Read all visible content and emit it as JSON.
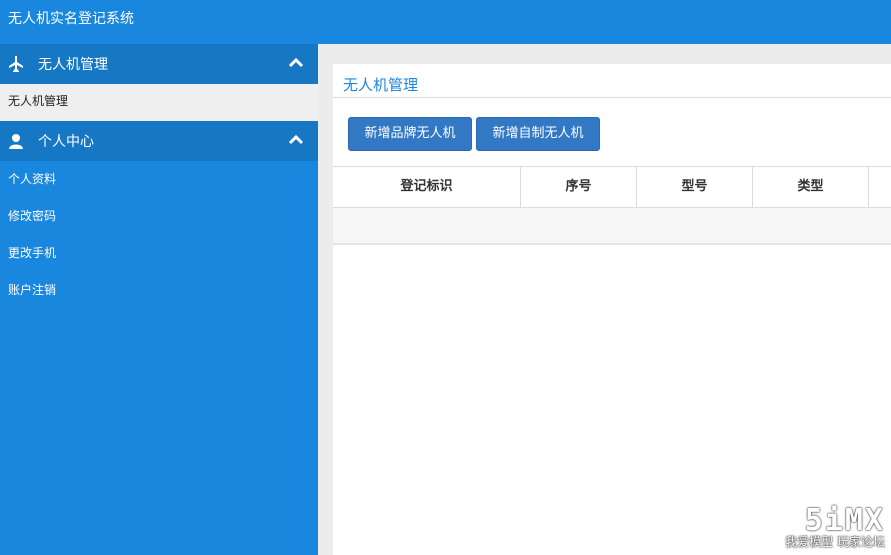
{
  "header": {
    "title": "无人机实名登记系统"
  },
  "sidebar": {
    "sections": [
      {
        "label": "无人机管理",
        "icon": "airplane-icon",
        "items": [
          {
            "label": "无人机管理",
            "active": true
          }
        ]
      },
      {
        "label": "个人中心",
        "icon": "user-icon",
        "items": [
          {
            "label": "个人资料"
          },
          {
            "label": "修改密码"
          },
          {
            "label": "更改手机"
          },
          {
            "label": "账户注销"
          }
        ]
      }
    ]
  },
  "main": {
    "title": "无人机管理",
    "buttons": {
      "add_brand": "新增品牌无人机",
      "add_custom": "新增自制无人机"
    },
    "table": {
      "columns": [
        "登记标识",
        "序号",
        "型号",
        "类型"
      ],
      "rows": []
    }
  },
  "watermark": {
    "logo": "5iMX",
    "text": "我爱模型 玩家论坛"
  },
  "colors": {
    "primary": "#1a87de",
    "section_header": "#1677c5",
    "button": "#3278c4"
  }
}
